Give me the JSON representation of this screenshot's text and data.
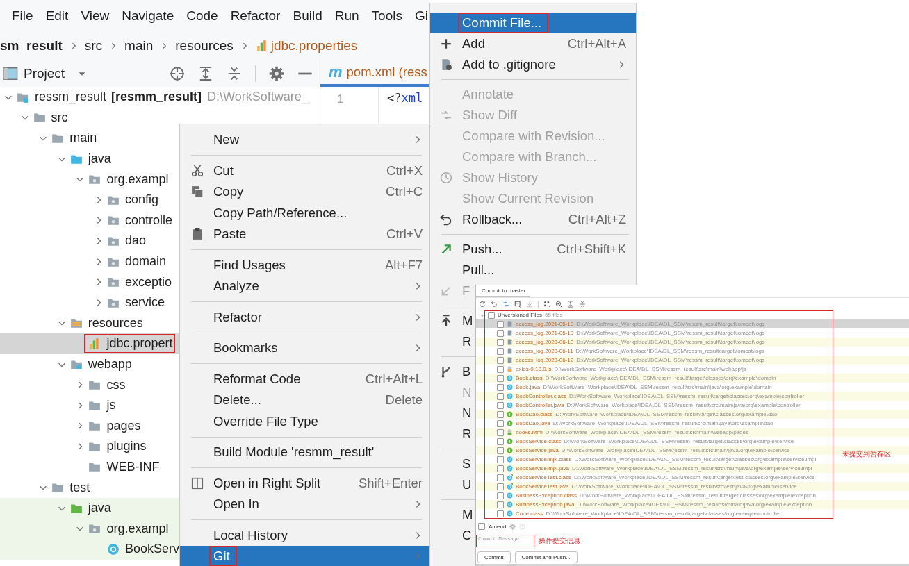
{
  "menu_bar": [
    "File",
    "Edit",
    "View",
    "Navigate",
    "Code",
    "Refactor",
    "Build",
    "Run",
    "Tools",
    "Gi"
  ],
  "breadcrumb": [
    {
      "label": "sm_result",
      "kind": "project"
    },
    {
      "label": "src",
      "kind": "folder"
    },
    {
      "label": "main",
      "kind": "folder"
    },
    {
      "label": "resources",
      "kind": "folder"
    },
    {
      "label": "jdbc.properties",
      "kind": "file"
    }
  ],
  "project_panel": {
    "title": "Project"
  },
  "editor": {
    "tab": {
      "icon_text": "m",
      "label": "pom.xml (ress"
    },
    "line_number": "1",
    "code": [
      {
        "text": "<?",
        "kind": "punct"
      },
      {
        "text": "xml",
        "kind": "keyword"
      }
    ]
  },
  "tree": [
    {
      "name": "ressm_result",
      "module": "[resmm_result]",
      "path": "D:\\WorkSoftware_",
      "kind": "module",
      "expanded": true,
      "selected": false,
      "children": [
        {
          "name": "src",
          "kind": "folder",
          "expanded": true,
          "selected": false,
          "children": [
            {
              "name": "main",
              "kind": "folder",
              "expanded": true,
              "selected": false,
              "children": [
                {
                  "name": "java",
                  "kind": "source",
                  "expanded": true,
                  "selected": false,
                  "children": [
                    {
                      "name": "org.exampl",
                      "kind": "package",
                      "expanded": true,
                      "selected": false,
                      "children": [
                        {
                          "name": "config",
                          "kind": "package",
                          "expanded": false,
                          "selected": false
                        },
                        {
                          "name": "controlle",
                          "kind": "package",
                          "expanded": false,
                          "selected": false
                        },
                        {
                          "name": "dao",
                          "kind": "package",
                          "expanded": false,
                          "selected": false
                        },
                        {
                          "name": "domain",
                          "kind": "package",
                          "expanded": false,
                          "selected": false
                        },
                        {
                          "name": "exceptio",
                          "kind": "package",
                          "expanded": false,
                          "selected": false
                        },
                        {
                          "name": "service",
                          "kind": "package",
                          "expanded": false,
                          "selected": false
                        }
                      ]
                    }
                  ]
                },
                {
                  "name": "resources",
                  "kind": "resources",
                  "expanded": true,
                  "selected": false,
                  "children": [
                    {
                      "name": "jdbc.propert",
                      "kind": "properties",
                      "selected": true,
                      "highlighted": true
                    }
                  ]
                },
                {
                  "name": "webapp",
                  "kind": "web",
                  "expanded": true,
                  "selected": false,
                  "children": [
                    {
                      "name": "css",
                      "kind": "folder",
                      "expanded": false,
                      "selected": false
                    },
                    {
                      "name": "js",
                      "kind": "folder",
                      "expanded": false,
                      "selected": false
                    },
                    {
                      "name": "pages",
                      "kind": "folder",
                      "expanded": false,
                      "selected": false
                    },
                    {
                      "name": "plugins",
                      "kind": "folder",
                      "expanded": false,
                      "selected": false
                    },
                    {
                      "name": "WEB-INF",
                      "kind": "folder",
                      "selected": false
                    }
                  ]
                }
              ]
            },
            {
              "name": "test",
              "kind": "folder",
              "expanded": true,
              "selected": false,
              "children": [
                {
                  "name": "java",
                  "kind": "test-source",
                  "expanded": true,
                  "selected": false,
                  "children": [
                    {
                      "name": "org.exampl",
                      "kind": "package",
                      "expanded": true,
                      "selected": false,
                      "children": [
                        {
                          "name": "BookServ",
                          "kind": "class",
                          "selected": false
                        }
                      ]
                    }
                  ]
                }
              ]
            }
          ]
        }
      ]
    }
  ],
  "context_menu": [
    {
      "kind": "plain",
      "label": "New",
      "submenu": true,
      "selected": false
    },
    {
      "kind": "separator"
    },
    {
      "kind": "scissors",
      "label": "Cut",
      "shortcut": "Ctrl+X",
      "selected": false
    },
    {
      "kind": "copy",
      "label": "Copy",
      "shortcut": "Ctrl+C",
      "selected": false
    },
    {
      "kind": "plain",
      "label": "Copy Path/Reference...",
      "selected": false
    },
    {
      "kind": "paste",
      "label": "Paste",
      "shortcut": "Ctrl+V",
      "selected": false
    },
    {
      "kind": "separator"
    },
    {
      "kind": "plain",
      "label": "Find Usages",
      "shortcut": "Alt+F7",
      "selected": false
    },
    {
      "kind": "plain",
      "label": "Analyze",
      "submenu": true,
      "selected": false
    },
    {
      "kind": "separator"
    },
    {
      "kind": "plain",
      "label": "Refactor",
      "submenu": true,
      "selected": false
    },
    {
      "kind": "separator"
    },
    {
      "kind": "plain",
      "label": "Bookmarks",
      "submenu": true,
      "selected": false
    },
    {
      "kind": "separator"
    },
    {
      "kind": "plain",
      "label": "Reformat Code",
      "shortcut": "Ctrl+Alt+L",
      "selected": false
    },
    {
      "kind": "plain",
      "label": "Delete...",
      "shortcut": "Delete",
      "selected": false
    },
    {
      "kind": "plain",
      "label": "Override File Type",
      "selected": false
    },
    {
      "kind": "separator"
    },
    {
      "kind": "plain",
      "label": "Build Module 'resmm_result'",
      "selected": false
    },
    {
      "kind": "separator"
    },
    {
      "kind": "split",
      "label": "Open in Right Split",
      "shortcut": "Shift+Enter",
      "selected": false
    },
    {
      "kind": "plain",
      "label": "Open In",
      "submenu": true,
      "selected": false
    },
    {
      "kind": "separator"
    },
    {
      "kind": "plain",
      "label": "Local History",
      "submenu": true,
      "selected": false
    },
    {
      "kind": "plain",
      "label": "Git",
      "submenu": true,
      "selected": true,
      "highlighted": true
    }
  ],
  "git_menu": [
    {
      "kind": "plain",
      "label": "Commit File...",
      "selected": true,
      "disabled": false,
      "highlighted": true
    },
    {
      "kind": "plus",
      "label": "Add",
      "shortcut": "Ctrl+Alt+A",
      "selected": false,
      "disabled": false
    },
    {
      "kind": "gitignore",
      "label": "Add to .gitignore",
      "submenu": true,
      "selected": false,
      "disabled": false
    },
    {
      "kind": "separator"
    },
    {
      "kind": "plain",
      "label": "Annotate",
      "selected": false,
      "disabled": true
    },
    {
      "kind": "diff",
      "label": "Show Diff",
      "selected": false,
      "disabled": true
    },
    {
      "kind": "plain",
      "label": "Compare with Revision...",
      "selected": false,
      "disabled": true
    },
    {
      "kind": "plain",
      "label": "Compare with Branch...",
      "selected": false,
      "disabled": true
    },
    {
      "kind": "clock",
      "label": "Show History",
      "selected": false,
      "disabled": true
    },
    {
      "kind": "plain",
      "label": "Show Current Revision",
      "selected": false,
      "disabled": true
    },
    {
      "kind": "rollback",
      "label": "Rollback...",
      "shortcut": "Ctrl+Alt+Z",
      "selected": false,
      "disabled": false
    },
    {
      "kind": "separator"
    },
    {
      "kind": "push",
      "label": "Push...",
      "shortcut": "Ctrl+Shift+K",
      "selected": false,
      "disabled": false
    },
    {
      "kind": "plain",
      "label": "Pull...",
      "selected": false,
      "disabled": false
    },
    {
      "kind": "fetch",
      "label": "F",
      "selected": false,
      "disabled": true
    },
    {
      "kind": "separator"
    },
    {
      "kind": "merge",
      "label": "M",
      "selected": false,
      "disabled": false
    },
    {
      "kind": "plain",
      "label": "R",
      "selected": false,
      "disabled": false
    },
    {
      "kind": "separator"
    },
    {
      "kind": "branch",
      "label": "B",
      "selected": false,
      "disabled": false
    },
    {
      "kind": "plain",
      "label": "N",
      "selected": false,
      "disabled": true
    },
    {
      "kind": "plain",
      "label": "N",
      "selected": false,
      "disabled": false
    },
    {
      "kind": "plain",
      "label": "R",
      "selected": false,
      "disabled": false
    },
    {
      "kind": "separator"
    },
    {
      "kind": "plain",
      "label": "S",
      "selected": false,
      "disabled": false
    },
    {
      "kind": "plain",
      "label": "U",
      "selected": false,
      "disabled": false
    },
    {
      "kind": "separator"
    },
    {
      "kind": "plain",
      "label": "M",
      "selected": false,
      "disabled": false
    },
    {
      "kind": "plain",
      "label": "C",
      "selected": false,
      "disabled": false
    }
  ],
  "commit_dialog": {
    "title": "Commit to master",
    "file_list": {
      "highlighted": true,
      "group": {
        "label": "Unversioned Files",
        "count": "65 files",
        "expanded": true,
        "checked": false
      },
      "files": [
        {
          "name": "access_log.2021-05-18",
          "path": "D:\\WorkSoftware_Workplace\\IDEA\\DL_SSM\\ressm_result\\target\\tomcat\\logs",
          "kind": "log",
          "checked": false,
          "selected": true
        },
        {
          "name": "access_log.2021-05-19",
          "path": "D:\\WorkSoftware_Workplace\\IDEA\\DL_SSM\\ressm_result\\target\\tomcat\\logs",
          "kind": "log",
          "checked": false,
          "selected": false
        },
        {
          "name": "access_log.2023-06-10",
          "path": "D:\\WorkSoftware_Workplace\\IDEA\\DL_SSM\\ressm_result\\target\\tomcat\\logs",
          "kind": "log",
          "checked": false,
          "selected": false
        },
        {
          "name": "access_log.2023-06-11",
          "path": "D:\\WorkSoftware_Workplace\\IDEA\\DL_SSM\\ressm_result\\target\\tomcat\\logs",
          "kind": "log",
          "checked": false,
          "selected": false
        },
        {
          "name": "access_log.2023-06-12",
          "path": "D:\\WorkSoftware_Workplace\\IDEA\\DL_SSM\\ressm_result\\target\\tomcat\\logs",
          "kind": "log",
          "checked": false,
          "selected": false
        },
        {
          "name": "axios-0.18.0.js",
          "path": "D:\\WorkSoftware_Workplace\\IDEA\\DL_SSM\\ressm_result\\src\\main\\webapp\\js",
          "kind": "js",
          "checked": false,
          "selected": false
        },
        {
          "name": "Book.class",
          "path": "D:\\WorkSoftware_Workplace\\IDEA\\DL_SSM\\ressm_result\\target\\classes\\org\\example\\domain",
          "kind": "class",
          "checked": false,
          "selected": false
        },
        {
          "name": "Book.java",
          "path": "D:\\WorkSoftware_Workplace\\IDEA\\DL_SSM\\ressm_result\\src\\main\\java\\org\\example\\domain",
          "kind": "class",
          "checked": false,
          "selected": false
        },
        {
          "name": "BookController.class",
          "path": "D:\\WorkSoftware_Workplace\\IDEA\\DL_SSM\\ressm_result\\target\\classes\\org\\example\\controller",
          "kind": "class",
          "checked": false,
          "selected": false
        },
        {
          "name": "BookController.java",
          "path": "D:\\WorkSoftware_Workplace\\IDEA\\DL_SSM\\ressm_result\\src\\main\\java\\org\\example\\controller",
          "kind": "class",
          "checked": false,
          "selected": false
        },
        {
          "name": "BookDao.class",
          "path": "D:\\WorkSoftware_Workplace\\IDEA\\DL_SSM\\ressm_result\\target\\classes\\org\\example\\dao",
          "kind": "interface",
          "checked": false,
          "selected": false
        },
        {
          "name": "BookDao.java",
          "path": "D:\\WorkSoftware_Workplace\\IDEA\\DL_SSM\\ressm_result\\src\\main\\java\\org\\example\\dao",
          "kind": "interface",
          "checked": false,
          "selected": false
        },
        {
          "name": "books.html",
          "path": "D:\\WorkSoftware_Workplace\\IDEA\\DL_SSM\\ressm_result\\src\\main\\webapp\\pages",
          "kind": "html",
          "checked": false,
          "selected": false
        },
        {
          "name": "BookService.class",
          "path": "D:\\WorkSoftware_Workplace\\IDEA\\DL_SSM\\ressm_result\\target\\classes\\org\\example\\service",
          "kind": "interface",
          "checked": false,
          "selected": false
        },
        {
          "name": "BookService.java",
          "path": "D:\\WorkSoftware_Workplace\\IDEA\\DL_SSM\\ressm_result\\src\\main\\java\\org\\example\\service",
          "kind": "interface",
          "checked": false,
          "selected": false
        },
        {
          "name": "BookServiceImpl.class",
          "path": "D:\\WorkSoftware_Workplace\\IDEA\\DL_SSM\\ressm_result\\target\\classes\\org\\example\\service\\impl",
          "kind": "class",
          "checked": false,
          "selected": false
        },
        {
          "name": "BookServiceImpl.java",
          "path": "D:\\WorkSoftware_Workplace\\IDEA\\DL_SSM\\ressm_result\\src\\main\\java\\org\\example\\service\\impl",
          "kind": "class",
          "checked": false,
          "selected": false
        },
        {
          "name": "BookServiceTest.class",
          "path": "D:\\WorkSoftware_Workplace\\IDEA\\DL_SSM\\ressm_result\\target\\test-classes\\org\\example\\service",
          "kind": "test-class",
          "checked": false,
          "selected": false
        },
        {
          "name": "BookServiceTest.java",
          "path": "D:\\WorkSoftware_Workplace\\IDEA\\DL_SSM\\ressm_result\\src\\test\\java\\org\\example\\service",
          "kind": "test-class",
          "checked": false,
          "selected": false
        },
        {
          "name": "BusinessException.class",
          "path": "D:\\WorkSoftware_Workplace\\IDEA\\DL_SSM\\ressm_result\\target\\classes\\org\\example\\exception",
          "kind": "class",
          "checked": false,
          "selected": false
        },
        {
          "name": "BusinessException.java",
          "path": "D:\\WorkSoftware_Workplace\\IDEA\\DL_SSM\\ressm_result\\src\\main\\java\\org\\example\\exception",
          "kind": "class",
          "checked": false,
          "selected": false
        },
        {
          "name": "Code.class",
          "path": "D:\\WorkSoftware_Workplace\\IDEA\\DL_SSM\\ressm_result\\target\\classes\\org\\example\\controller",
          "kind": "class",
          "checked": false,
          "selected": false
        }
      ]
    },
    "list_note": "未提交到暂存区",
    "amend": {
      "label": "Amend",
      "checked": false
    },
    "message": {
      "placeholder": "Commit Message",
      "highlighted": true
    },
    "message_note": "操作提交信息",
    "buttons": [
      "Commit",
      "Commit and Push..."
    ]
  }
}
